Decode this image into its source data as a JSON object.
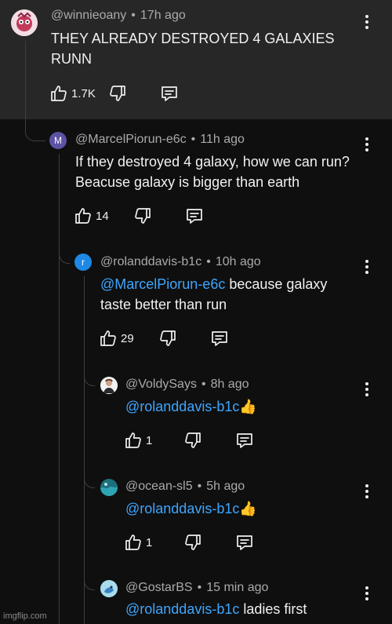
{
  "comments": [
    {
      "user": "@winnieoany",
      "time": "17h ago",
      "text": "THEY ALREADY DESTROYED 4 GALAXIES RUNN",
      "likes": "1.7K",
      "avatar_letter": ""
    },
    {
      "user": "@MarcelPiorun-e6c",
      "time": "11h ago",
      "text": "If they destroyed 4 galaxy, how we can run? Beacuse galaxy is bigger than earth",
      "likes": "14",
      "avatar_letter": "M"
    },
    {
      "user": "@rolanddavis-b1c",
      "time": "10h ago",
      "mention": "@MarcelPiorun-e6c",
      "text": " because galaxy taste better than run",
      "likes": "29",
      "avatar_letter": "r"
    },
    {
      "user": "@VoldySays",
      "time": "8h ago",
      "mention": "@rolanddavis-b1c",
      "text": "👍",
      "likes": "1",
      "avatar_letter": ""
    },
    {
      "user": "@ocean-sl5",
      "time": "5h ago",
      "mention": "@rolanddavis-b1c",
      "text": "👍",
      "likes": "1",
      "avatar_letter": ""
    },
    {
      "user": "@GostarBS",
      "time": "15 min ago",
      "mention": "@rolanddavis-b1c",
      "text": " ladies first",
      "likes": "",
      "avatar_letter": ""
    }
  ],
  "separator": "•",
  "watermark": "imgflip.com",
  "colors": {
    "background": "#0f0f0f",
    "highlight_section": "#272727",
    "mention": "#3ea6ff",
    "meta_text": "#aaaaaa"
  }
}
